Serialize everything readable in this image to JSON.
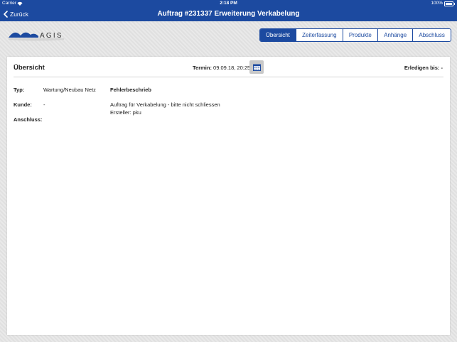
{
  "statusbar": {
    "carrier": "Carrier",
    "time": "2:18 PM",
    "battery": "100%"
  },
  "navbar": {
    "back_label": "Zurück",
    "title": "Auftrag #231337 Erweiterung Verkabelung"
  },
  "logo": {
    "text": "AGIS"
  },
  "tabs": [
    {
      "label": "Übersicht",
      "active": true
    },
    {
      "label": "Zeiterfassung",
      "active": false
    },
    {
      "label": "Produkte",
      "active": false
    },
    {
      "label": "Anhänge",
      "active": false
    },
    {
      "label": "Abschluss",
      "active": false
    }
  ],
  "overview": {
    "heading": "Übersicht",
    "termin_label": "Termin:",
    "termin_value": "09.09.18, 20:25",
    "erledigen_label": "Erledigen bis:",
    "erledigen_value": "-",
    "typ_label": "Typ:",
    "typ_value": "Wartung/Neubau Netz",
    "kunde_label": "Kunde:",
    "kunde_value": "-",
    "anschluss_label": "Anschluss:",
    "fehler_label": "Fehlerbeschrieb",
    "fehler_line1": "Auftrag für Verkabelung - bitte nicht schliessen",
    "fehler_line2": "Ersteller: pku"
  },
  "colors": {
    "brand": "#1c4aa0",
    "background": "#e4e4e4"
  }
}
